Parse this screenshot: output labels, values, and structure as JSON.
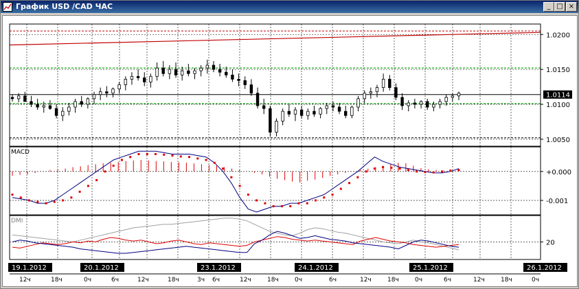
{
  "window": {
    "title": "График USD /CAD  ЧАС",
    "minimize_label": "_",
    "maximize_label": "□",
    "close_label": "×"
  },
  "price_panel": {
    "ticks": [
      "1.0200",
      "1.0150",
      "1.0100",
      "1.0050"
    ],
    "tick_values": [
      1.02,
      1.015,
      1.01,
      1.005
    ],
    "current_price": "1.0114",
    "current_value": 1.0114,
    "channel_upper_start": 1.0185,
    "channel_upper_end": 1.0203,
    "red_dashed_level": 1.0205,
    "green_levels": [
      1.0152,
      1.0101
    ],
    "black_dashed_level": 1.0052,
    "ylim": [
      1.004,
      1.0215
    ],
    "candles": [
      [
        1.011,
        1.0114,
        1.0104,
        1.0108
      ],
      [
        1.0108,
        1.0116,
        1.0103,
        1.0112
      ],
      [
        1.0112,
        1.0118,
        1.0106,
        1.0104
      ],
      [
        1.0104,
        1.0112,
        1.0096,
        1.01
      ],
      [
        1.01,
        1.0108,
        1.0092,
        1.0096
      ],
      [
        1.0096,
        1.0104,
        1.0088,
        1.0098
      ],
      [
        1.0098,
        1.0106,
        1.0092,
        1.0094
      ],
      [
        1.0094,
        1.01,
        1.008,
        1.0084
      ],
      [
        1.0084,
        1.0096,
        1.0076,
        1.009
      ],
      [
        1.009,
        1.0102,
        1.0084,
        1.0096
      ],
      [
        1.0096,
        1.0108,
        1.0088,
        1.0104
      ],
      [
        1.0104,
        1.0112,
        1.0096,
        1.01
      ],
      [
        1.01,
        1.011,
        1.0094,
        1.0108
      ],
      [
        1.0108,
        1.0118,
        1.01,
        1.0114
      ],
      [
        1.0114,
        1.0124,
        1.0106,
        1.0118
      ],
      [
        1.0118,
        1.0126,
        1.011,
        1.0116
      ],
      [
        1.0116,
        1.0124,
        1.011,
        1.0122
      ],
      [
        1.0122,
        1.0132,
        1.0116,
        1.0128
      ],
      [
        1.0128,
        1.014,
        1.012,
        1.0136
      ],
      [
        1.0136,
        1.0146,
        1.0128,
        1.014
      ],
      [
        1.014,
        1.015,
        1.0134,
        1.0138
      ],
      [
        1.0138,
        1.0146,
        1.0126,
        1.0132
      ],
      [
        1.0132,
        1.0144,
        1.0124,
        1.014
      ],
      [
        1.014,
        1.016,
        1.0134,
        1.0152
      ],
      [
        1.0152,
        1.0162,
        1.014,
        1.0144
      ],
      [
        1.0144,
        1.0156,
        1.0136,
        1.015
      ],
      [
        1.015,
        1.016,
        1.0138,
        1.0142
      ],
      [
        1.0142,
        1.0154,
        1.0134,
        1.0148
      ],
      [
        1.0148,
        1.0158,
        1.014,
        1.0144
      ],
      [
        1.0144,
        1.0152,
        1.0136,
        1.0148
      ],
      [
        1.0148,
        1.0156,
        1.014,
        1.0152
      ],
      [
        1.0152,
        1.0164,
        1.0144,
        1.0156
      ],
      [
        1.0156,
        1.0162,
        1.0146,
        1.015
      ],
      [
        1.015,
        1.0158,
        1.014,
        1.0146
      ],
      [
        1.0146,
        1.0154,
        1.0138,
        1.0142
      ],
      [
        1.0142,
        1.015,
        1.0132,
        1.0136
      ],
      [
        1.0136,
        1.0144,
        1.0126,
        1.0134
      ],
      [
        1.0134,
        1.014,
        1.0122,
        1.0128
      ],
      [
        1.0128,
        1.0136,
        1.0112,
        1.0116
      ],
      [
        1.0116,
        1.0124,
        1.0094,
        1.0098
      ],
      [
        1.0098,
        1.0108,
        1.0086,
        1.0094
      ],
      [
        1.0094,
        1.0098,
        1.0054,
        1.006
      ],
      [
        1.006,
        1.008,
        1.0054,
        1.0076
      ],
      [
        1.0076,
        1.0094,
        1.007,
        1.009
      ],
      [
        1.009,
        1.01,
        1.0082,
        1.0086
      ],
      [
        1.0086,
        1.0096,
        1.0076,
        1.0092
      ],
      [
        1.0092,
        1.0098,
        1.008,
        1.0084
      ],
      [
        1.0084,
        1.0094,
        1.0078,
        1.009
      ],
      [
        1.009,
        1.0098,
        1.0082,
        1.0086
      ],
      [
        1.0086,
        1.0096,
        1.008,
        1.0094
      ],
      [
        1.0094,
        1.0102,
        1.0086,
        1.0098
      ],
      [
        1.0098,
        1.0104,
        1.009,
        1.0096
      ],
      [
        1.0096,
        1.0102,
        1.0086,
        1.009
      ],
      [
        1.009,
        1.0098,
        1.008,
        1.0084
      ],
      [
        1.0084,
        1.0098,
        1.008,
        1.0096
      ],
      [
        1.0096,
        1.0112,
        1.009,
        1.0108
      ],
      [
        1.0108,
        1.012,
        1.0102,
        1.0116
      ],
      [
        1.0116,
        1.0124,
        1.0108,
        1.0118
      ],
      [
        1.0118,
        1.0128,
        1.011,
        1.0124
      ],
      [
        1.0124,
        1.0144,
        1.0118,
        1.0136
      ],
      [
        1.0136,
        1.0142,
        1.012,
        1.0124
      ],
      [
        1.0124,
        1.013,
        1.0106,
        1.011
      ],
      [
        1.011,
        1.0116,
        1.0092,
        1.0098
      ],
      [
        1.0098,
        1.0106,
        1.009,
        1.0102
      ],
      [
        1.0102,
        1.0108,
        1.0094,
        1.01
      ],
      [
        1.01,
        1.0106,
        1.0094,
        1.0104
      ],
      [
        1.0104,
        1.0108,
        1.0092,
        1.0096
      ],
      [
        1.0096,
        1.0104,
        1.009,
        1.01
      ],
      [
        1.01,
        1.0108,
        1.0094,
        1.0104
      ],
      [
        1.0104,
        1.0114,
        1.0098,
        1.011
      ],
      [
        1.011,
        1.0116,
        1.0104,
        1.0112
      ],
      [
        1.0112,
        1.0118,
        1.0106,
        1.0116
      ]
    ]
  },
  "macd_panel": {
    "label": "MACD",
    "ticks": [
      "+0.000",
      "-0.001"
    ],
    "tick_values": [
      0.0,
      -0.001
    ],
    "ylim": [
      -0.0015,
      0.00085
    ],
    "histogram": [
      -0.00015,
      -0.00012,
      -0.0001,
      -5e-05,
      0.0,
      5e-05,
      8e-05,
      0.0001,
      0.00015,
      0.00018,
      0.00022,
      0.00025,
      0.00028,
      0.0003,
      0.00033,
      0.00036,
      0.00038,
      0.0004,
      0.00038,
      0.00036,
      0.00035,
      0.00033,
      0.00032,
      0.0003,
      0.00028,
      0.00025,
      0.00022,
      0.0002,
      0.00015,
      0.0001,
      5e-05,
      0.0,
      -5e-05,
      -0.0001,
      -0.00018,
      -0.00025,
      -0.0003,
      -0.00035,
      -0.00038,
      -0.00032,
      -0.00028,
      -0.00022,
      -0.00015,
      -0.0001,
      -5e-05,
      0.0,
      5e-05,
      0.0001,
      0.00015,
      0.0002,
      0.00025,
      0.0003,
      0.00028,
      0.0002,
      0.00012,
      8e-05,
      5e-05,
      3e-05,
      2e-05,
      1e-05
    ],
    "macd": [
      -0.0009,
      -0.00095,
      -0.001,
      -0.0011,
      -0.0011,
      -0.001,
      -0.0008,
      -0.0006,
      -0.0004,
      -0.0002,
      0.0,
      0.0002,
      0.0004,
      0.0005,
      0.0006,
      0.0007,
      0.0007,
      0.0007,
      0.00065,
      0.0006,
      0.0006,
      0.0006,
      0.00055,
      0.0005,
      0.0003,
      0.0,
      -0.0004,
      -0.0009,
      -0.0013,
      -0.0014,
      -0.0013,
      -0.0012,
      -0.0012,
      -0.0011,
      -0.0011,
      -0.001,
      -0.0009,
      -0.0008,
      -0.0006,
      -0.0004,
      -0.0002,
      0.0,
      0.00025,
      0.0005,
      0.00035,
      0.00025,
      0.00015,
      0.0001,
      5e-05,
      0.0,
      -5e-05,
      -5e-05,
      0.0,
      0.0001
    ],
    "signal": [
      -0.0008,
      -0.0009,
      -0.001,
      -0.00105,
      -0.0011,
      -0.00105,
      -0.001,
      -0.0009,
      -0.0007,
      -0.0005,
      -0.0003,
      0.0,
      0.0002,
      0.0004,
      0.0005,
      0.0006,
      0.0006,
      0.0006,
      0.00058,
      0.00055,
      0.00052,
      0.0005,
      0.00045,
      0.0004,
      0.0003,
      0.0001,
      -0.0002,
      -0.0005,
      -0.0008,
      -0.001,
      -0.0011,
      -0.0012,
      -0.0012,
      -0.0012,
      -0.0011,
      -0.0011,
      -0.001,
      -0.0009,
      -0.0008,
      -0.0006,
      -0.0004,
      -0.0002,
      0.0,
      0.0001,
      0.00015,
      0.00013,
      0.0001,
      5e-05,
      0.0,
      -2e-05,
      -3e-05,
      0.0,
      3e-05,
      5e-05
    ]
  },
  "dmi_panel": {
    "label": "DMI",
    "ticks": [
      "20"
    ],
    "tick_values": [
      20
    ],
    "ylim": [
      0,
      50
    ],
    "adx": [
      28,
      27,
      26,
      25,
      24,
      23,
      22,
      21,
      20,
      22,
      24,
      26,
      28,
      30,
      32,
      34,
      36,
      37,
      38,
      39,
      40,
      40,
      41,
      42,
      43,
      44,
      45,
      46,
      47,
      47,
      46,
      44,
      40,
      36,
      32,
      30,
      28,
      27,
      30,
      34,
      36,
      35,
      33,
      31,
      30,
      28,
      26,
      24,
      22,
      20,
      19,
      18,
      20,
      22,
      20,
      19,
      17,
      15,
      13,
      11
    ],
    "plus_di": [
      14,
      13,
      15,
      17,
      19,
      18,
      17,
      18,
      20,
      19,
      21,
      20,
      23,
      25,
      24,
      22,
      21,
      22,
      20,
      18,
      19,
      21,
      22,
      20,
      18,
      17,
      19,
      18,
      17,
      16,
      15,
      16,
      20,
      22,
      24,
      26,
      25,
      23,
      22,
      21,
      22,
      21,
      20,
      19,
      18,
      17,
      21,
      23,
      25,
      23,
      21,
      20,
      19,
      17,
      16,
      15,
      14,
      15,
      16,
      17
    ],
    "minus_di": [
      20,
      22,
      21,
      19,
      18,
      17,
      16,
      15,
      14,
      12,
      11,
      10,
      9,
      8,
      7,
      7,
      8,
      9,
      10,
      11,
      12,
      13,
      14,
      15,
      14,
      13,
      12,
      11,
      10,
      9,
      8,
      8,
      18,
      22,
      28,
      32,
      30,
      27,
      24,
      25,
      27,
      25,
      23,
      22,
      21,
      19,
      18,
      17,
      16,
      15,
      14,
      12,
      16,
      20,
      22,
      21,
      19,
      17,
      15,
      14
    ]
  },
  "time_axis": {
    "date_labels": [
      "19.1.2012",
      "20.1.2012",
      "23.1.2012",
      "24.1.2012",
      "25.1.2012",
      "26.1.2012"
    ],
    "hour_labels": [
      "12ч",
      "18ч",
      "0ч",
      "6ч",
      "12ч",
      "18ч",
      "3ч",
      "6ч",
      "12ч",
      "18ч",
      "0ч",
      "6ч",
      "12ч",
      "18ч",
      "0ч",
      "6ч",
      "12ч",
      "18ч",
      "0ч"
    ]
  },
  "colors": {
    "title_start": "#0a246a",
    "title_end": "#3a6ea5",
    "channel": "#c00000",
    "green_level": "#00a000",
    "macd_line": "#000080",
    "signal_dots": "#e00000",
    "adx": "#a0a0a0",
    "plus_di": "#e00000",
    "minus_di": "#000080",
    "label_bg": "#000000"
  }
}
